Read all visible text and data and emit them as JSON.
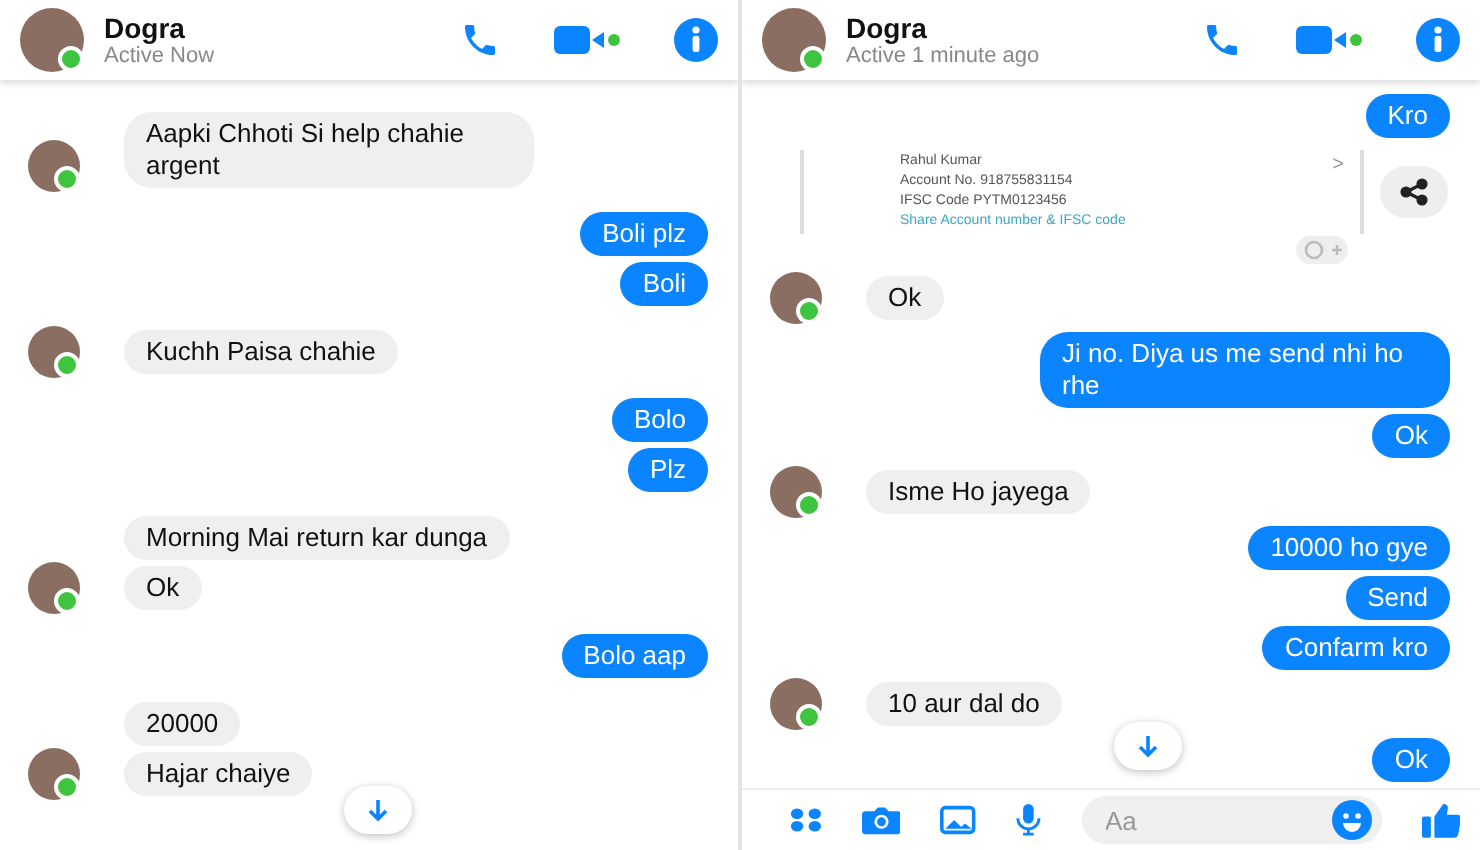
{
  "panels": [
    {
      "contact": {
        "name": "Dogra",
        "status": "Active Now",
        "online": true
      },
      "messages": [
        {
          "kind": "received",
          "text": "Aapki Chhoti Si help chahie argent",
          "avatar": true
        },
        {
          "kind": "sent",
          "text": "Boli plz"
        },
        {
          "kind": "sent",
          "text": "Boli"
        },
        {
          "kind": "received",
          "text": "Kuchh Paisa chahie",
          "avatar": true
        },
        {
          "kind": "sent",
          "text": "Bolo"
        },
        {
          "kind": "sent",
          "text": "Plz"
        },
        {
          "kind": "received",
          "text": "Morning Mai return kar dunga",
          "avatar": false
        },
        {
          "kind": "received",
          "text": "Ok",
          "avatar": true
        },
        {
          "kind": "sent",
          "text": "Bolo aap"
        },
        {
          "kind": "received",
          "text": "20000",
          "avatar": false
        },
        {
          "kind": "received",
          "text": "Hajar chaiye",
          "avatar": true
        }
      ]
    },
    {
      "contact": {
        "name": "Dogra",
        "status": "Active 1 minute ago",
        "online": true
      },
      "messages": [
        {
          "kind": "sent",
          "text": "Kro"
        },
        {
          "kind": "card",
          "name": "Rahul Kumar",
          "account": "Account No. 918755831154",
          "ifsc": "IFSC Code PYTM0123456",
          "link": "Share Account number & IFSC code",
          "chevron": ">"
        },
        {
          "kind": "received",
          "text": "Ok",
          "avatar": true
        },
        {
          "kind": "sent",
          "text": "Ji no. Diya us me send nhi ho rhe"
        },
        {
          "kind": "sent",
          "text": "Ok"
        },
        {
          "kind": "received",
          "text": "Isme Ho jayega",
          "avatar": true
        },
        {
          "kind": "sent",
          "text": "10000 ho gye"
        },
        {
          "kind": "sent",
          "text": "Send"
        },
        {
          "kind": "sent",
          "text": "Confarm kro"
        },
        {
          "kind": "received",
          "text": "10 aur dal do",
          "avatar": true
        },
        {
          "kind": "sent",
          "text": "Ok"
        }
      ],
      "composer": {
        "placeholder": "Aa"
      }
    }
  ]
}
